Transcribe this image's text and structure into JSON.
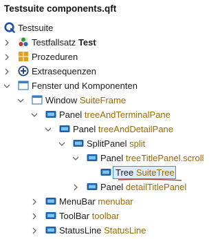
{
  "window": {
    "title": "Testsuite components.qft"
  },
  "colors": {
    "accent": "#3d8fd6",
    "name_color": "#9a6a00",
    "selection_bg": "#dcebfa",
    "underline": "#c0392b"
  },
  "tree": {
    "root": {
      "label": "Testsuite",
      "icon": "qf-test-logo-icon"
    },
    "testfallsatz": {
      "prefix": "Testfallsatz",
      "name": "Test",
      "icon": "testcase-set-icon"
    },
    "prozeduren": {
      "label": "Prozeduren",
      "icon": "procedures-icon"
    },
    "extrasequenzen": {
      "label": "Extrasequenzen",
      "icon": "extras-icon"
    },
    "fenster": {
      "label": "Fenster und Komponenten",
      "icon": "windows-components-icon"
    },
    "window": {
      "kind": "Window",
      "name": "SuiteFrame",
      "icon": "window-icon"
    },
    "panel1": {
      "kind": "Panel",
      "name": "treeAndTerminalPane",
      "icon": "panel-icon"
    },
    "panel2": {
      "kind": "Panel",
      "name": "treeAndDetailPane",
      "icon": "panel-icon"
    },
    "splitpanel": {
      "kind": "SplitPanel",
      "name": "split",
      "icon": "panel-icon"
    },
    "panel3": {
      "kind": "Panel",
      "name": "treeTitlePanel.scroll",
      "icon": "panel-icon"
    },
    "tree_node": {
      "kind": "Tree",
      "name": "SuiteTree",
      "icon": "panel-icon"
    },
    "panel4": {
      "kind": "Panel",
      "name": "detailTitlePanel",
      "icon": "panel-icon"
    },
    "menubar": {
      "kind": "MenuBar",
      "name": "menubar",
      "icon": "panel-icon"
    },
    "toolbar": {
      "kind": "ToolBar",
      "name": "toolbar",
      "icon": "panel-icon"
    },
    "statusline": {
      "kind": "StatusLine",
      "name": "StatusLine",
      "icon": "panel-icon"
    }
  }
}
